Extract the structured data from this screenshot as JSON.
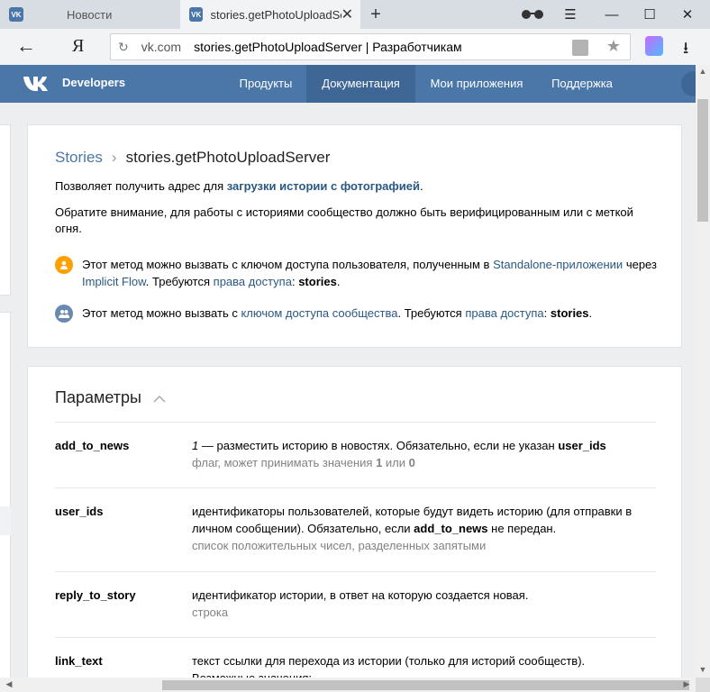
{
  "browser": {
    "tabs": [
      {
        "favicon": "VK",
        "title": "Новости"
      },
      {
        "favicon": "VK",
        "title": "stories.getPhotoUploadSe"
      }
    ],
    "new_tab_symbol": "+",
    "window_controls": {
      "menu": "☰",
      "minimize": "—",
      "maximize": "☐",
      "close": "✕"
    },
    "back_symbol": "←",
    "yandex_symbol": "Я",
    "address": {
      "reload_symbol": "↻",
      "domain": "vk.com",
      "page_title": "stories.getPhotoUploadServer | Разработчикам"
    },
    "star_symbol": "★",
    "download_symbol": "⭳"
  },
  "vk_header": {
    "brand": "Developers",
    "nav": [
      "Продукты",
      "Документация",
      "Мои приложения",
      "Поддержка"
    ],
    "active_nav": "Документация",
    "accent": "#4a76a8"
  },
  "method_card": {
    "breadcrumb_section": "Stories",
    "breadcrumb_sep": "›",
    "breadcrumb_current": "stories.getPhotoUploadServer",
    "desc_prefix": "Позволяет получить адрес для",
    "desc_link": "загрузки истории с фотографией",
    "desc_suffix": ".",
    "notice": "Обратите внимание, для работы с историями сообщество должно быть верифицированным или с меткой огня.",
    "note_user": {
      "t1": "Этот метод можно вызвать с ключом доступа пользователя, полученным в",
      "l1": "Standalone-приложении",
      "t2": "через",
      "l2": "Implicit Flow",
      "t3": ". Требуются",
      "l3": "права доступа",
      "t4": ":",
      "scope": "stories",
      "t5": "."
    },
    "note_group": {
      "t1": "Этот метод можно вызвать с",
      "l1": "ключом доступа сообщества",
      "t2": ". Требуются",
      "l2": "права доступа",
      "t3": ":",
      "scope": "stories",
      "t4": "."
    }
  },
  "params_card": {
    "title": "Параметры",
    "rows": [
      {
        "name": "add_to_news",
        "desc_italic": "1",
        "desc_a": " — разместить историю в новостях. Обязательно, если не указан ",
        "desc_bold": "user_ids",
        "type_a": "флаг, может принимать значения ",
        "type_b1": "1",
        "type_mid": " или ",
        "type_b2": "0"
      },
      {
        "name": "user_ids",
        "desc_a": "идентификаторы пользователей, которые будут видеть историю (для отправки в личном сообщении). Обязательно, если ",
        "desc_bold": "add_to_news",
        "desc_b": " не передан.",
        "type": "список положительных чисел, разделенных запятыми"
      },
      {
        "name": "reply_to_story",
        "desc": "идентификатор истории, в ответ на которую создается новая.",
        "type": "строка"
      },
      {
        "name": "link_text",
        "desc": "текст ссылки для перехода из истории (только для историй сообществ).",
        "desc2": "Возможные значения:"
      }
    ]
  },
  "scrollbar": {
    "up": "▲",
    "down": "▼",
    "left": "◀",
    "right": "▶"
  }
}
